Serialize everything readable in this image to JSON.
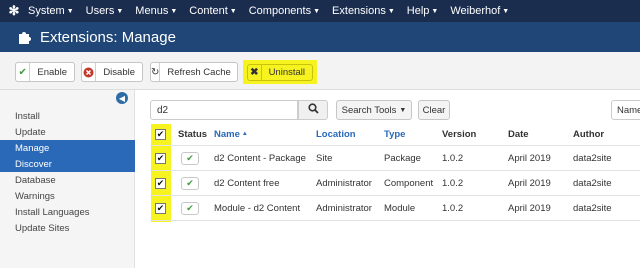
{
  "topnav": {
    "items": [
      {
        "label": "System"
      },
      {
        "label": "Users"
      },
      {
        "label": "Menus"
      },
      {
        "label": "Content"
      },
      {
        "label": "Components"
      },
      {
        "label": "Extensions"
      },
      {
        "label": "Help"
      },
      {
        "label": "Weiberhof"
      }
    ]
  },
  "header": {
    "title": "Extensions: Manage"
  },
  "toolbar": {
    "enable_label": "Enable",
    "disable_label": "Disable",
    "refresh_label": "Refresh Cache",
    "uninstall_label": "Uninstall"
  },
  "sidebar": {
    "items": [
      {
        "label": "Install"
      },
      {
        "label": "Update"
      },
      {
        "label": "Manage"
      },
      {
        "label": "Discover"
      },
      {
        "label": "Database"
      },
      {
        "label": "Warnings"
      },
      {
        "label": "Install Languages"
      },
      {
        "label": "Update Sites"
      }
    ]
  },
  "filters": {
    "search_value": "d2",
    "search_tools_label": "Search Tools",
    "clear_label": "Clear",
    "sort_value": "Name"
  },
  "table": {
    "headers": {
      "status": "Status",
      "name": "Name",
      "location": "Location",
      "type": "Type",
      "version": "Version",
      "date": "Date",
      "author": "Author"
    },
    "rows": [
      {
        "name": "d2 Content - Package",
        "location": "Site",
        "type": "Package",
        "version": "1.0.2",
        "date": "April 2019",
        "author": "data2site"
      },
      {
        "name": "d2 Content free",
        "location": "Administrator",
        "type": "Component",
        "version": "1.0.2",
        "date": "April 2019",
        "author": "data2site"
      },
      {
        "name": "Module - d2 Content",
        "location": "Administrator",
        "type": "Module",
        "version": "1.0.2",
        "date": "April 2019",
        "author": "data2site"
      }
    ]
  },
  "colors": {
    "topnav_bg": "#1b2d4f",
    "header_bg": "#1f4676",
    "highlight": "#f6f321",
    "active_sidebar": "#2a69b8"
  }
}
